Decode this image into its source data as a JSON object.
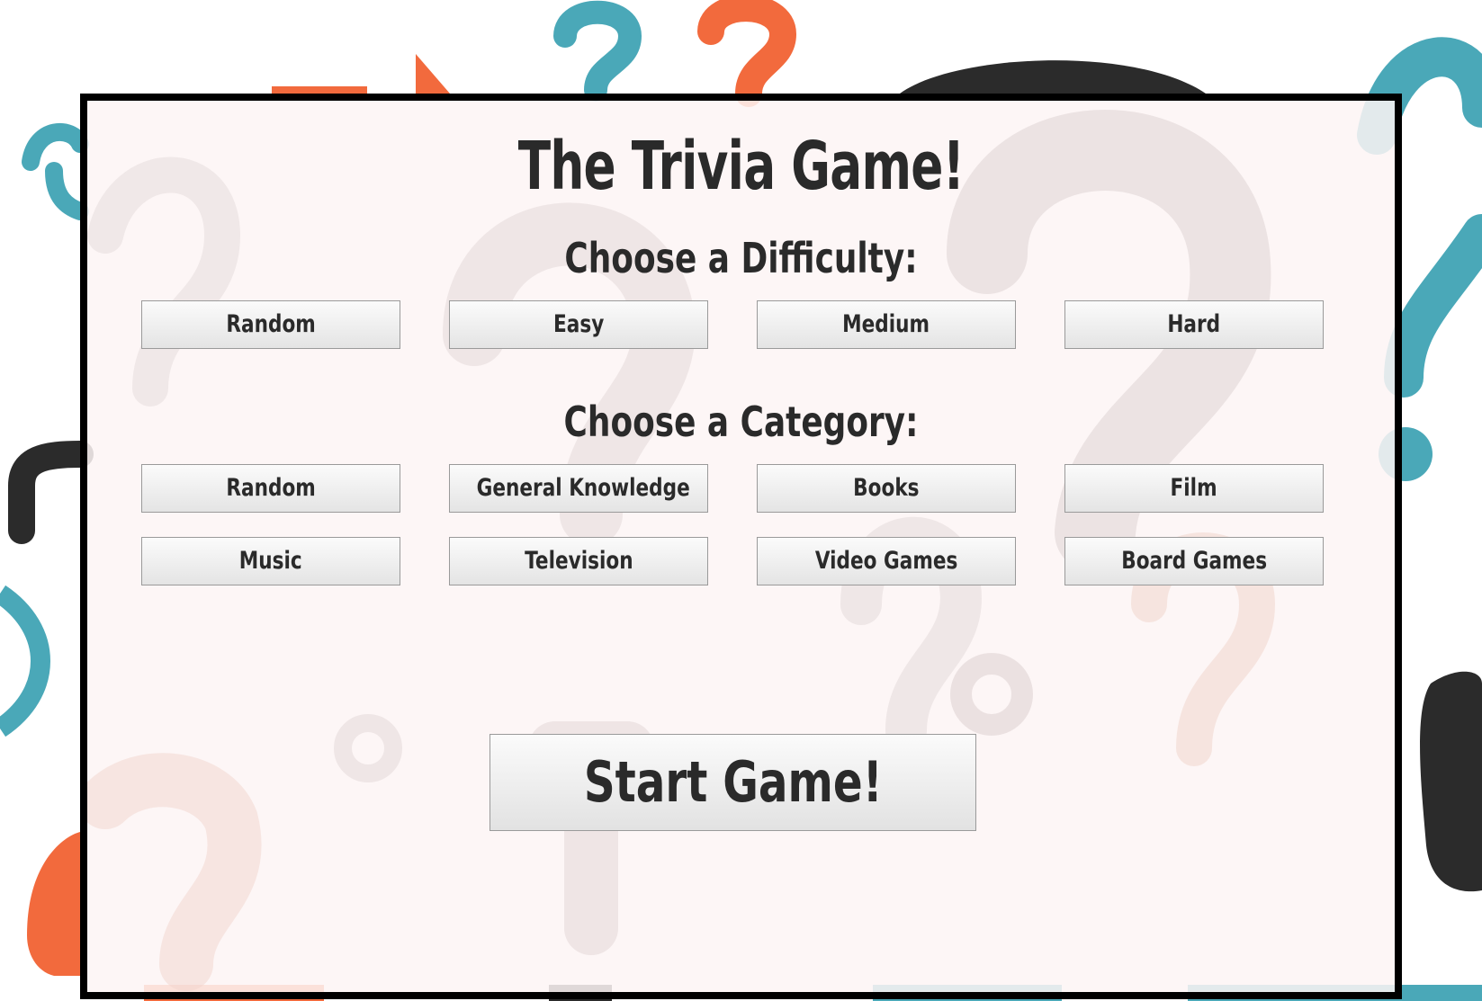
{
  "game": {
    "title": "The Trivia Game!",
    "difficulty_heading": "Choose a Difficulty:",
    "category_heading": "Choose a Category:",
    "difficulties": [
      {
        "label": "Random"
      },
      {
        "label": "Easy"
      },
      {
        "label": "Medium"
      },
      {
        "label": "Hard"
      }
    ],
    "categories": [
      {
        "label": "Random"
      },
      {
        "label": "General Knowledge"
      },
      {
        "label": "Books"
      },
      {
        "label": "Film"
      },
      {
        "label": "Music"
      },
      {
        "label": "Television"
      },
      {
        "label": "Video Games"
      },
      {
        "label": "Board Games"
      }
    ],
    "start_label": "Start Game!"
  },
  "colors": {
    "text": "#2a2a2a",
    "border": "#000000",
    "panel": "#fdf4f4",
    "accent_teal": "#4aa8b8",
    "accent_orange": "#f26a3d",
    "accent_dark": "#2b2b2b"
  },
  "background": {
    "icon": "question-mark-pattern"
  }
}
